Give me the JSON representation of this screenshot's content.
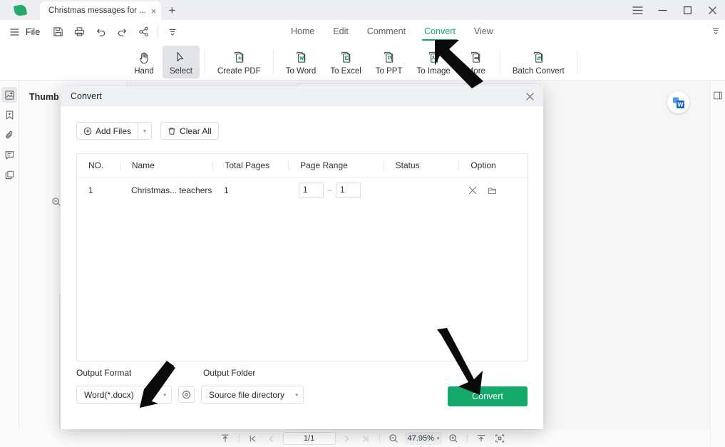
{
  "titlebar": {
    "logo": "pdf-app-logo",
    "tab_label": "Christmas messages for ...",
    "tab_close": "×",
    "new_tab": "+",
    "menu": "☰",
    "minimize": "—",
    "maximize": "□",
    "close": "×"
  },
  "quickbar": {
    "menu_icon": "hamburger-icon",
    "file_label": "File",
    "items": [
      "save-icon",
      "print-icon",
      "undo-icon",
      "redo-icon",
      "share-icon",
      "more-icon"
    ]
  },
  "ribbon_tabs": [
    {
      "label": "Home",
      "active": false
    },
    {
      "label": "Edit",
      "active": false
    },
    {
      "label": "Comment",
      "active": false
    },
    {
      "label": "Convert",
      "active": true
    },
    {
      "label": "View",
      "active": false
    }
  ],
  "toolbar": [
    {
      "label": "Hand",
      "icon": "hand-icon",
      "selected": false
    },
    {
      "label": "Select",
      "icon": "cursor-arrow-icon",
      "selected": true
    },
    {
      "label": "Create PDF",
      "icon": "create-pdf-icon",
      "selected": false
    },
    {
      "label": "To Word",
      "icon": "to-word-icon",
      "selected": false
    },
    {
      "label": "To Excel",
      "icon": "to-excel-icon",
      "selected": false
    },
    {
      "label": "To PPT",
      "icon": "to-ppt-icon",
      "selected": false
    },
    {
      "label": "To Image",
      "icon": "to-image-icon",
      "selected": false
    },
    {
      "label": "More",
      "icon": "more-convert-icon",
      "selected": false
    },
    {
      "label": "Batch Convert",
      "icon": "batch-convert-icon",
      "selected": false
    }
  ],
  "left_rail": [
    {
      "name": "thumbnail-panel-icon",
      "active": true
    },
    {
      "name": "bookmark-icon",
      "active": false
    },
    {
      "name": "attachment-icon",
      "active": false
    },
    {
      "name": "comment-panel-icon",
      "active": false
    },
    {
      "name": "layers-icon",
      "active": false
    }
  ],
  "thumbnail_panel": {
    "title": "Thumb",
    "zoom_out_icon": "zoom-out-icon",
    "slider": "thumbnail-size-slider"
  },
  "viewer": {
    "floating_word_button": "convert-to-word-fab",
    "right_panel_toggle": "right-panel-toggle-icon"
  },
  "statusbar": {
    "fit_top_icon": "scroll-to-top-icon",
    "first_page_icon": "first-page-icon",
    "prev_page_icon": "previous-page-icon",
    "page_indicator": "1/1",
    "next_page_icon": "next-page-icon",
    "last_page_icon": "last-page-icon",
    "zoom_out_icon": "zoom-out-icon",
    "zoom_value": "47.95%",
    "zoom_caret": "▾",
    "zoom_in_icon": "zoom-in-icon",
    "fit_width_icon": "fit-width-icon",
    "fit_page_icon": "fit-page-icon"
  },
  "dialog": {
    "title": "Convert",
    "close": "×",
    "add_files_label": "Add Files",
    "add_files_icon": "plus-circle-icon",
    "add_files_caret": "▾",
    "clear_all_label": "Clear All",
    "clear_all_icon": "trash-icon",
    "columns": [
      "NO.",
      "Name",
      "Total Pages",
      "Page Range",
      "Status",
      "Option"
    ],
    "rows": [
      {
        "no": "1",
        "name": "Christmas... teachers",
        "total_pages": "1",
        "range_from": "1",
        "range_dash": "–",
        "range_to": "1",
        "status": "",
        "remove_icon": "remove-file-icon",
        "folder_icon": "open-folder-icon"
      }
    ],
    "output_format_label": "Output Format",
    "output_format_value": "Word(*.docx)",
    "output_format_caret": "▾",
    "settings_icon": "format-settings-gear-icon",
    "output_folder_label": "Output Folder",
    "output_folder_value": "Source file directory",
    "output_folder_caret": "▾",
    "convert_button": "Convert"
  },
  "annotations": [
    {
      "name": "arrow-to-convert-tab",
      "direction": "up-left"
    },
    {
      "name": "arrow-to-output-format",
      "direction": "down-left"
    },
    {
      "name": "arrow-to-convert-button",
      "direction": "down-right"
    }
  ],
  "colors": {
    "accent_green": "#15a86b",
    "titlebar_bg": "#eceef2",
    "dialog_header_bg": "#eef0f4"
  }
}
